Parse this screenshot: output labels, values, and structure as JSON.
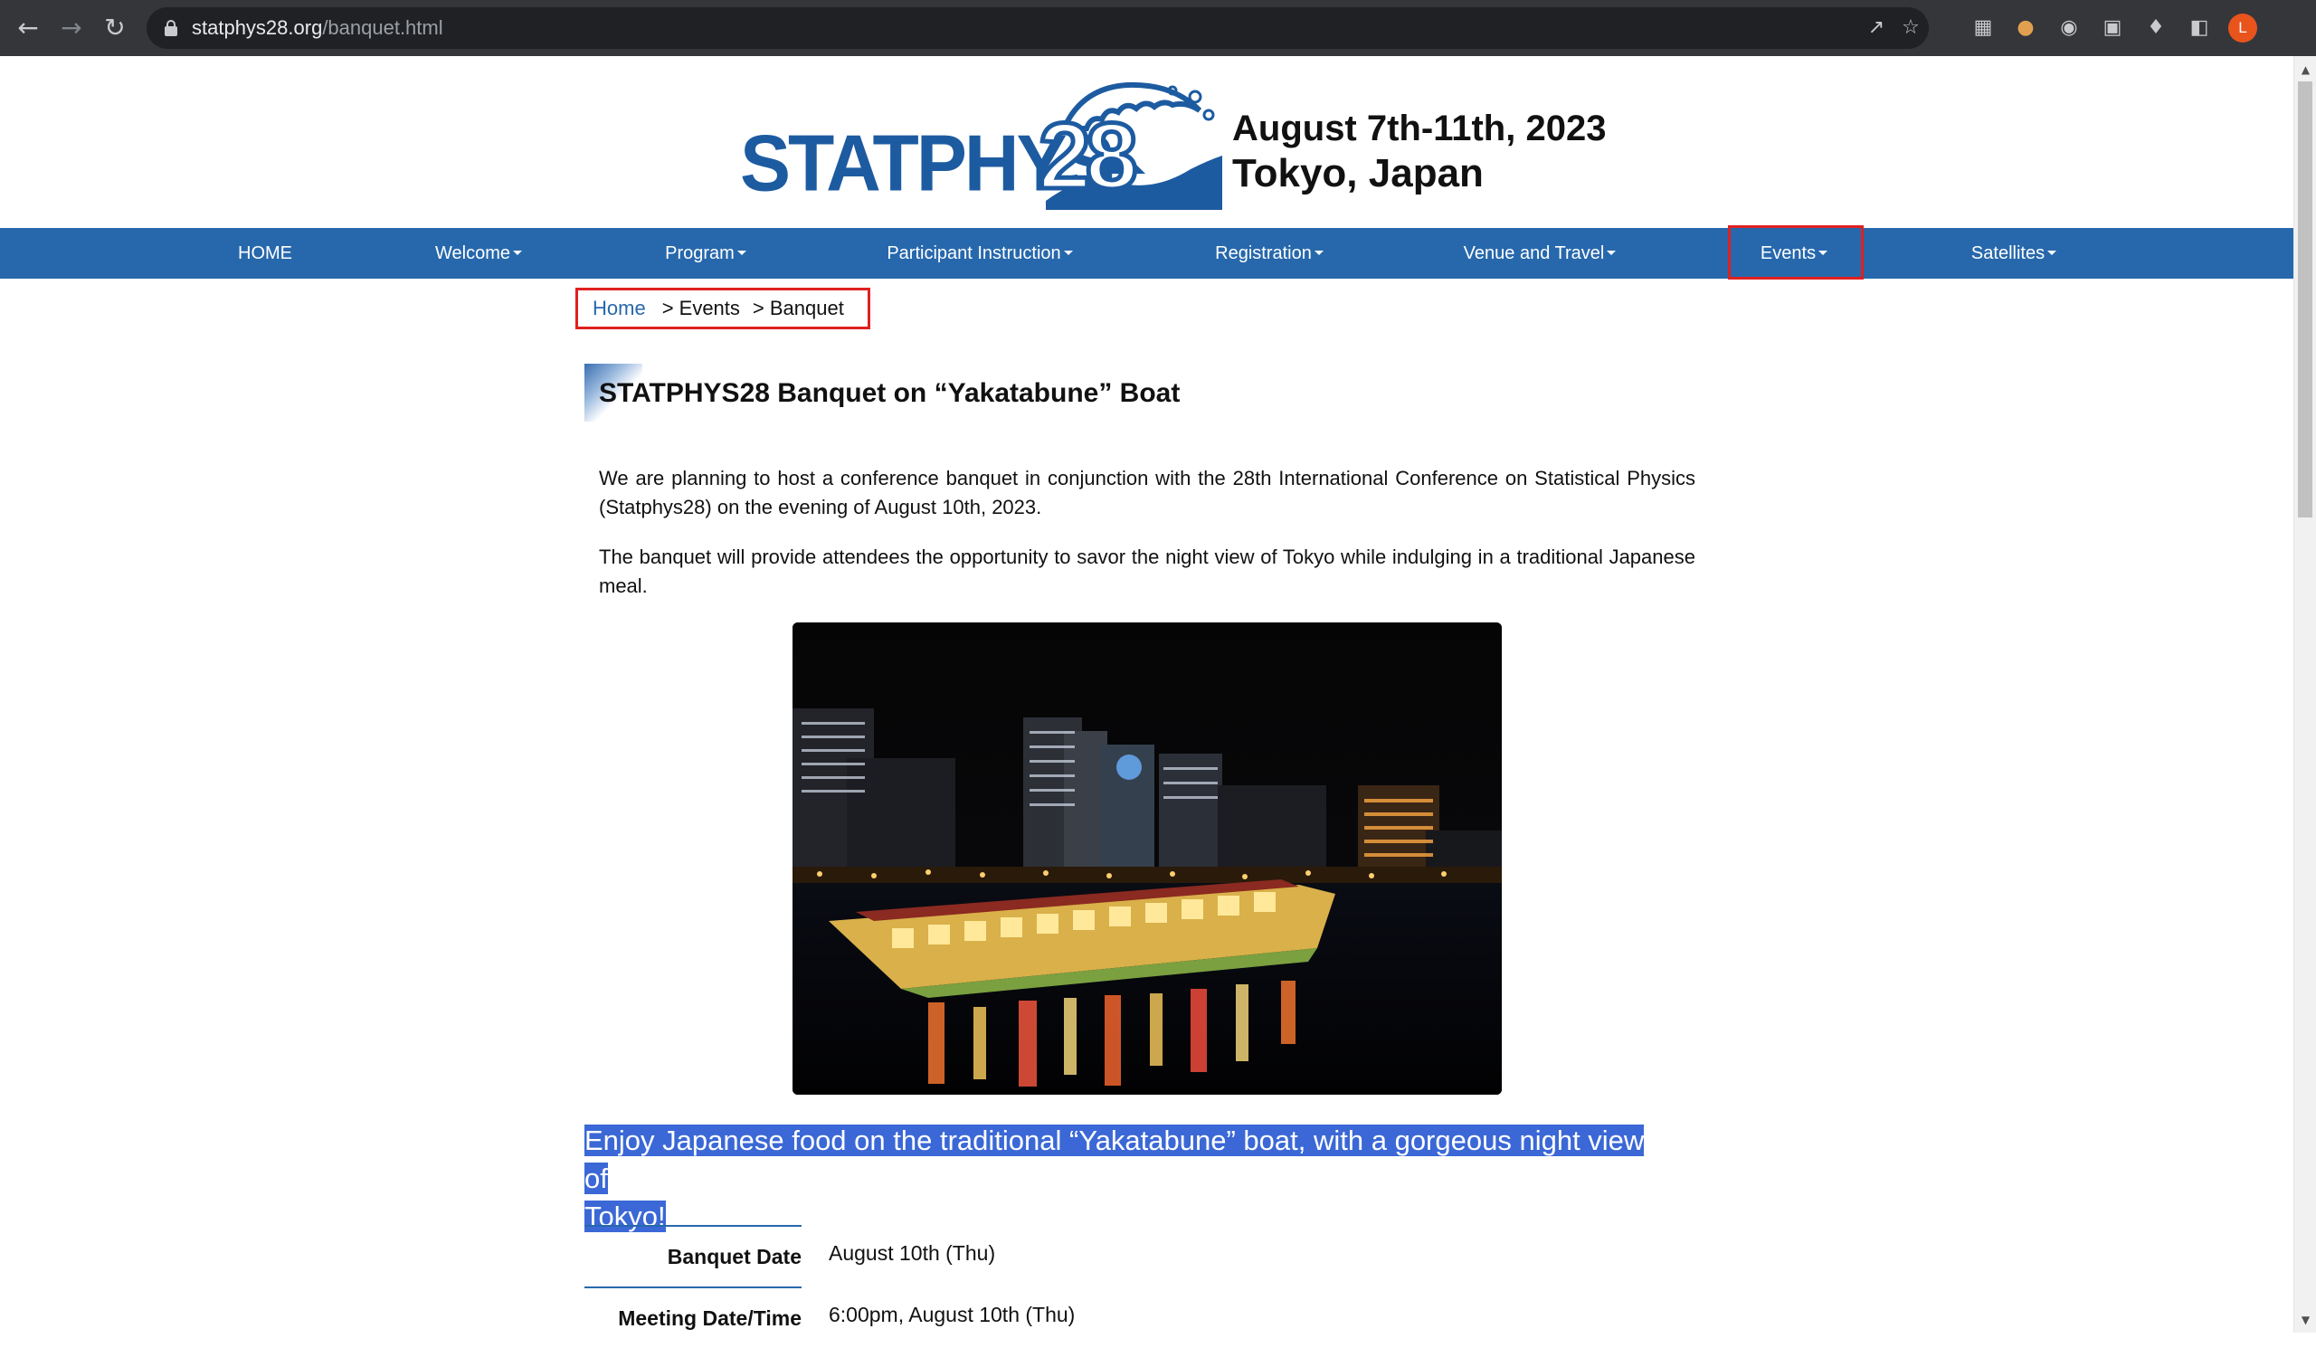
{
  "browser": {
    "url_domain": "statphys28.org",
    "url_path": "/banquet.html",
    "avatar_letter": "L",
    "icons": {
      "back": "back-arrow-icon",
      "forward": "forward-arrow-icon",
      "reload": "reload-icon",
      "share": "share-icon",
      "bookmark": "star-icon",
      "extensions": [
        "qr-code-icon",
        "cookie-icon",
        "circle-icon",
        "reader-icon",
        "puzzle-icon",
        "sidebar-icon"
      ]
    }
  },
  "header": {
    "logo_text": "STATPHYS",
    "logo_number": "28",
    "date_line": "August 7th-11th, 2023",
    "location_line": "Tokyo, Japan"
  },
  "nav": {
    "items": [
      {
        "label": "HOME",
        "dropdown": false
      },
      {
        "label": "Welcome",
        "dropdown": true
      },
      {
        "label": "Program",
        "dropdown": true
      },
      {
        "label": "Participant Instruction",
        "dropdown": true
      },
      {
        "label": "Registration",
        "dropdown": true
      },
      {
        "label": "Venue and Travel",
        "dropdown": true
      },
      {
        "label": "Events",
        "dropdown": true,
        "active": true
      },
      {
        "label": "Satellites",
        "dropdown": true
      }
    ]
  },
  "breadcrumb": {
    "home": "Home",
    "events": "> Events",
    "current": "> Banquet"
  },
  "page": {
    "title": "STATPHYS28 Banquet on “Yakatabune” Boat",
    "paragraph1": "We are planning to host a conference banquet in conjunction with the 28th International Conference on Statistical Physics (Statphys28) on the evening of August 10th, 2023.",
    "paragraph2": "The banquet will provide attendees the opportunity to savor the night view of Tokyo while indulging in a traditional Japanese meal.",
    "highlight_line1": "Enjoy Japanese food on the traditional “Yakatabune” boat, with a gorgeous night view of",
    "highlight_line2": "Tokyo!"
  },
  "details": [
    {
      "label": "Banquet Date",
      "value": "August 10th (Thu)"
    },
    {
      "label": "Meeting Date/Time",
      "value": "6:00pm, August 10th (Thu)"
    }
  ],
  "colors": {
    "brand_blue": "#2768ac",
    "selection_blue": "#3b68d6",
    "annotation_red": "#e02020"
  }
}
